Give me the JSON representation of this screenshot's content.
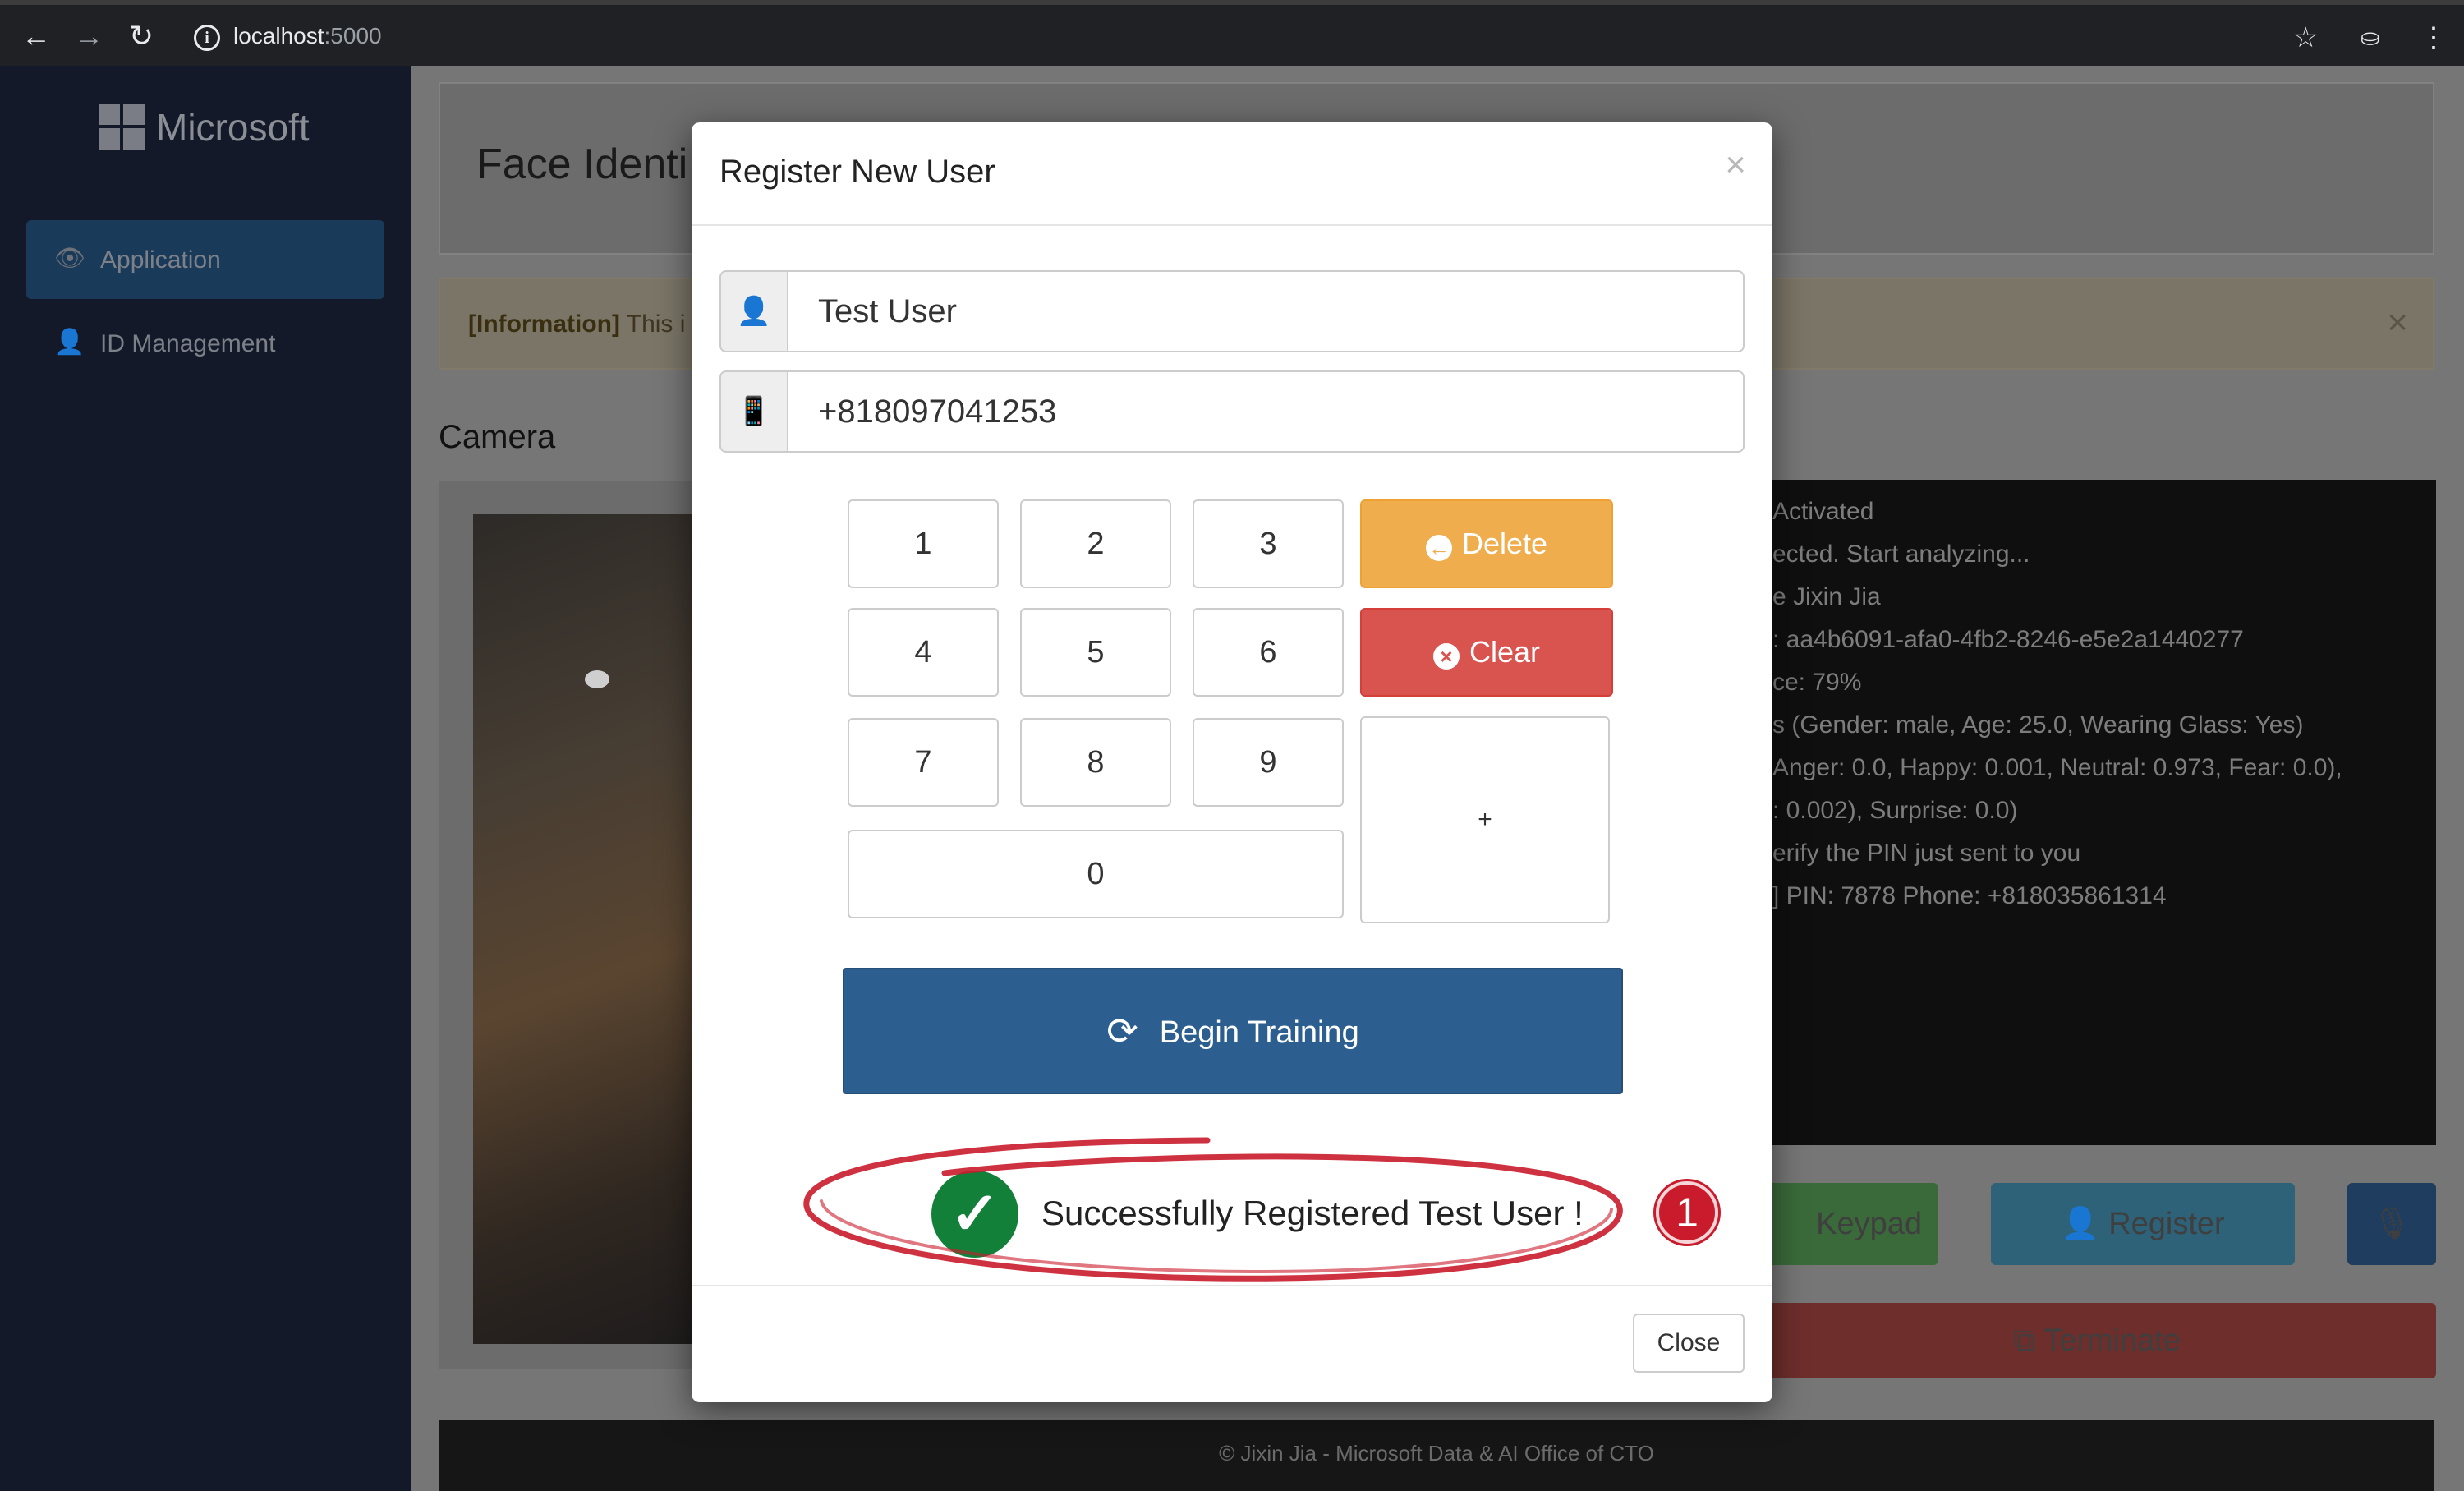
{
  "browser": {
    "url_host": "localhost",
    "url_port": ":5000",
    "back_icon": "←",
    "forward_icon": "→",
    "reload_icon": "↻",
    "info_icon": "i",
    "star_icon": "☆",
    "ext_icon": "⛀",
    "menu_icon": "⋮"
  },
  "sidebar": {
    "logo_text": "Microsoft",
    "items": [
      {
        "label": "Application",
        "icon": "👁"
      },
      {
        "label": "ID Management",
        "icon": "👤"
      }
    ]
  },
  "main": {
    "title": "Face Identi",
    "info_label": "[Information]",
    "info_text": " This i",
    "info_close": "×",
    "camera_label": "Camera",
    "log_lines": [
      "Activated",
      "ected. Start analyzing...",
      "e Jixin Jia",
      ": aa4b6091-afa0-4fb2-8246-e5e2a1440277",
      "ce: 79%",
      "s (Gender: male, Age: 25.0, Wearing Glass: Yes)",
      "Anger: 0.0, Happy: 0.001, Neutral: 0.973, Fear: 0.0),",
      ": 0.002), Surprise: 0.0)",
      "erify the PIN just sent to you",
      "] PIN: 7878 Phone: +818035861314"
    ],
    "keypad_button": "Keypad",
    "register_button": "Register",
    "terminate_button": "Terminate",
    "footer": "© Jixin Jia - Microsoft Data & AI Office of CTO"
  },
  "modal": {
    "title": "Register New User",
    "close_x": "×",
    "name_value": "Test User",
    "phone_value": "+818097041253",
    "keys": {
      "k1": "1",
      "k2": "2",
      "k3": "3",
      "k4": "4",
      "k5": "5",
      "k6": "6",
      "k7": "7",
      "k8": "8",
      "k9": "9",
      "k0": "0",
      "plus": "+"
    },
    "delete_label": "Delete",
    "clear_label": "Clear",
    "train_label": "Begin Training",
    "success_text": "Successfully Registered Test User !",
    "close_label": "Close"
  },
  "annotation": {
    "badge": "1",
    "color": "#c91b2b"
  },
  "colors": {
    "primary": "#2c5f8f",
    "warning": "#f0ad4e",
    "danger": "#d9534f",
    "success": "#13803a"
  }
}
